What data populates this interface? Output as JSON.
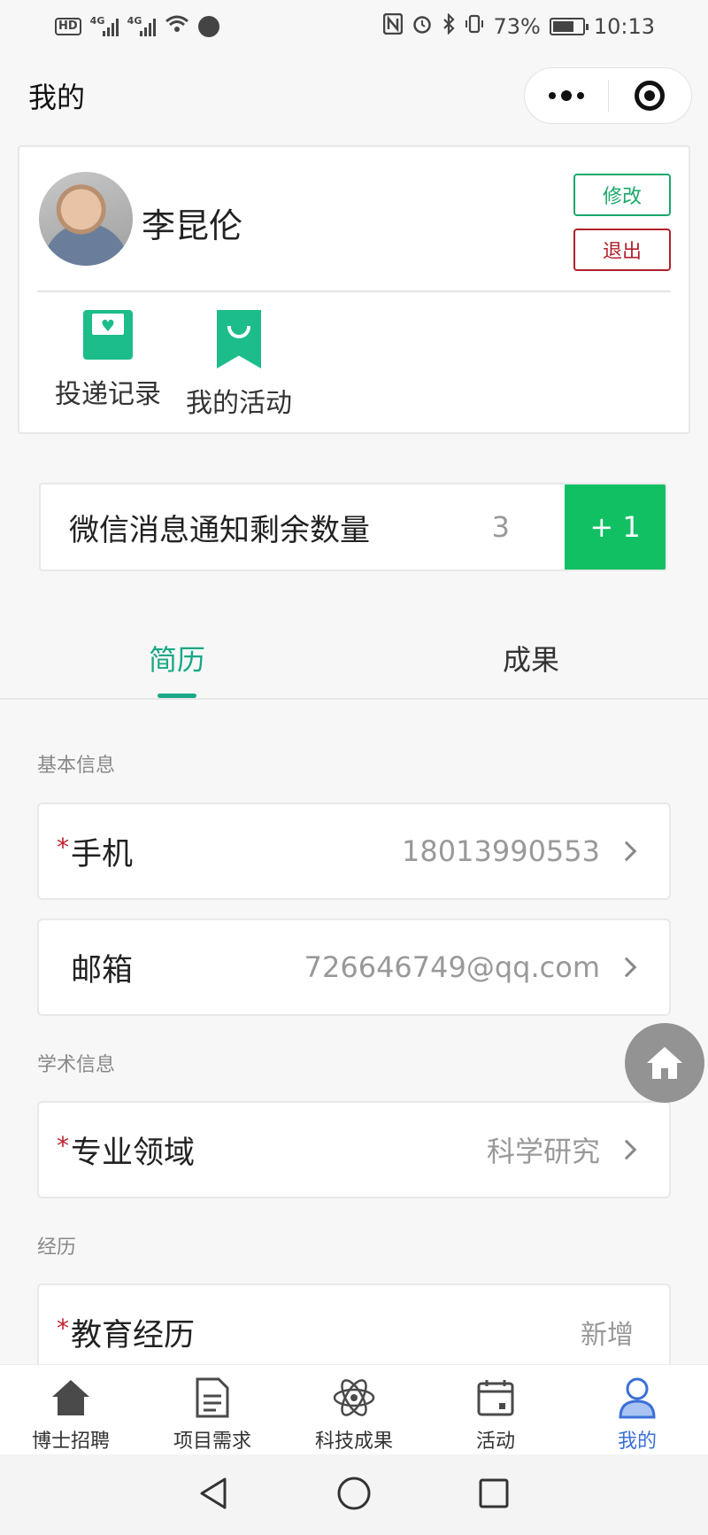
{
  "status_bar": {
    "battery": "73%",
    "time": "10:13",
    "network_1": "4G",
    "network_2": "4G",
    "hd": "HD"
  },
  "header": {
    "title": "我的"
  },
  "profile": {
    "name": "李昆伦",
    "edit_label": "修改",
    "logout_label": "退出",
    "shortcuts": [
      {
        "label": "投递记录",
        "icon": "mail-heart-icon"
      },
      {
        "label": "我的活动",
        "icon": "bookmark-smile-icon"
      }
    ]
  },
  "notify": {
    "label": "微信消息通知剩余数量",
    "count": "3",
    "button_label": "+ 1"
  },
  "tabs": [
    {
      "label": "简历",
      "active": true
    },
    {
      "label": "成果",
      "active": false
    }
  ],
  "sections": {
    "basic": {
      "title": "基本信息",
      "phone": {
        "label": "手机",
        "value": "18013990553",
        "required": true
      },
      "email": {
        "label": "邮箱",
        "value": "726646749@qq.com",
        "required": false
      }
    },
    "academic": {
      "title": "学术信息",
      "field": {
        "label": "专业领域",
        "value": "科学研究",
        "required": true
      }
    },
    "experience": {
      "title": "经历",
      "education": {
        "label": "教育经历",
        "action": "新增",
        "required": true
      }
    }
  },
  "tabbar": [
    {
      "label": "博士招聘",
      "icon": "home-icon",
      "active": false
    },
    {
      "label": "项目需求",
      "icon": "document-icon",
      "active": false
    },
    {
      "label": "科技成果",
      "icon": "atom-icon",
      "active": false
    },
    {
      "label": "活动",
      "icon": "calendar-icon",
      "active": false
    },
    {
      "label": "我的",
      "icon": "user-icon",
      "active": true
    }
  ],
  "colors": {
    "accent_green": "#1aa886",
    "button_green": "#12c064",
    "logout_red": "#b0202c",
    "tab_active_blue": "#3b6fd8"
  }
}
